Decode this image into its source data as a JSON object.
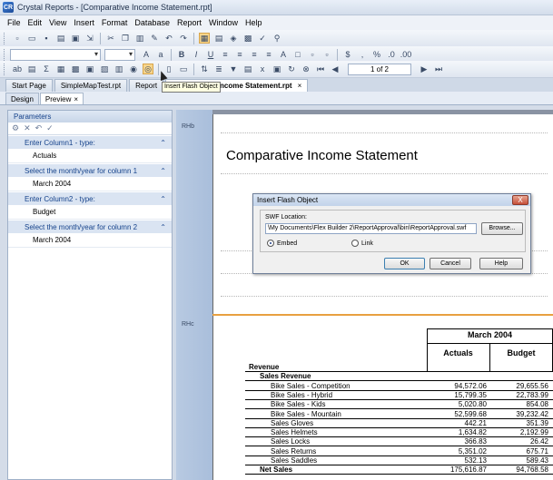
{
  "window": {
    "title": "Crystal Reports - [Comparative Income Statement.rpt]",
    "app_icon": "CR"
  },
  "menu": [
    "File",
    "Edit",
    "View",
    "Insert",
    "Format",
    "Database",
    "Report",
    "Window",
    "Help"
  ],
  "toolbar3": {
    "page_indicator": "1 of 2"
  },
  "tooltip": "Insert Flash Object",
  "doc_tabs": [
    {
      "label": "Start Page"
    },
    {
      "label": "SimpleMapTest.rpt"
    },
    {
      "label": "Report"
    },
    {
      "label": "Comparative Income Statement.rpt",
      "close": "×"
    }
  ],
  "sub_tabs": [
    {
      "label": "Design"
    },
    {
      "label": "Preview",
      "close": "×"
    }
  ],
  "parameters": {
    "header": "Parameters",
    "items": [
      {
        "prompt": "Enter Column1 - type:",
        "value": "Actuals"
      },
      {
        "prompt": "Select the month/year for column 1",
        "value": "March 2004"
      },
      {
        "prompt": "Enter Column2 - type:",
        "value": "Budget"
      },
      {
        "prompt": "Select the month/year for column 2",
        "value": "March 2004"
      }
    ]
  },
  "sections": {
    "rhb": "RHb",
    "rhc": "RHc"
  },
  "report": {
    "title": "Comparative Income Statement",
    "period": "March 2004",
    "col1": "Actuals",
    "col2": "Budget",
    "rows": [
      {
        "label": "Revenue",
        "indent": 0,
        "bold": true,
        "a": "",
        "b": ""
      },
      {
        "label": "Sales Revenue",
        "indent": 1,
        "bold": true,
        "a": "",
        "b": ""
      },
      {
        "label": "Bike Sales - Competition",
        "indent": 2,
        "bold": false,
        "a": "94,572.06",
        "b": "29,655.56"
      },
      {
        "label": "Bike Sales - Hybrid",
        "indent": 2,
        "bold": false,
        "a": "15,799.35",
        "b": "22,783.99"
      },
      {
        "label": "Bike Sales - Kids",
        "indent": 2,
        "bold": false,
        "a": "5,020.80",
        "b": "854.08"
      },
      {
        "label": "Bike Sales - Mountain",
        "indent": 2,
        "bold": false,
        "a": "52,599.68",
        "b": "39,232.42"
      },
      {
        "label": "Sales Gloves",
        "indent": 2,
        "bold": false,
        "a": "442.21",
        "b": "351.39"
      },
      {
        "label": "Sales Helmets",
        "indent": 2,
        "bold": false,
        "a": "1,634.82",
        "b": "2,192.99"
      },
      {
        "label": "Sales Locks",
        "indent": 2,
        "bold": false,
        "a": "366.83",
        "b": "26.42"
      },
      {
        "label": "Sales Returns",
        "indent": 2,
        "bold": false,
        "a": "5,351.02",
        "b": "675.71"
      },
      {
        "label": "Sales Saddles",
        "indent": 2,
        "bold": false,
        "a": "532.13",
        "b": "589.43"
      },
      {
        "label": "Net Sales",
        "indent": 1,
        "bold": true,
        "a": "175,616.87",
        "b": "94,768.58"
      }
    ]
  },
  "dialog": {
    "title": "Insert Flash Object",
    "close": "X",
    "swf_label": "SWF Location:",
    "swf_path": "\\My Documents\\Flex Builder 2\\ReportApproval\\bin\\ReportApproval.swf",
    "browse": "Browse...",
    "embed": "Embed",
    "link": "Link",
    "ok": "OK",
    "cancel": "Cancel",
    "help": "Help"
  }
}
